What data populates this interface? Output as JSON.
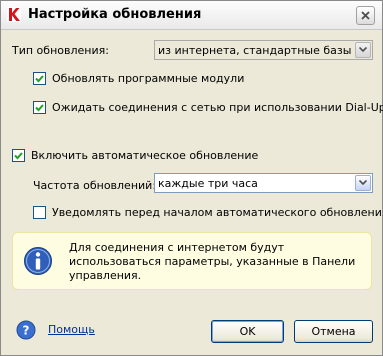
{
  "window": {
    "title": "Настройка обновления"
  },
  "update_type": {
    "label": "Тип обновления:",
    "value": "из интернета, стандартные базы"
  },
  "options": {
    "update_modules": {
      "label": "Обновлять программные модули",
      "checked": true
    },
    "wait_dialup": {
      "label": "Ожидать соединения с сетью при использовании Dial-Up",
      "checked": true
    },
    "auto_update": {
      "label": "Включить автоматическое обновление",
      "checked": true
    },
    "notify_before": {
      "label": "Уведомлять перед началом автоматического обновления",
      "checked": false
    }
  },
  "frequency": {
    "label": "Частота обновлений:",
    "value": "каждые три часа"
  },
  "info": {
    "text": "Для соединения с интернетом будут использоваться параметры, указанные в Панели управления."
  },
  "footer": {
    "help_label": "Помощь",
    "ok_label": "OK",
    "cancel_label": "Отмена"
  },
  "icons": {
    "app": "kaspersky-k-icon",
    "close": "close-icon",
    "info": "info-icon",
    "help": "help-icon",
    "dropdown": "chevron-down-icon",
    "check": "checkmark-icon"
  },
  "colors": {
    "info_bg": "#fffde1",
    "link": "#003399",
    "check": "#21a121",
    "info_icon": "#2f5fb8"
  }
}
